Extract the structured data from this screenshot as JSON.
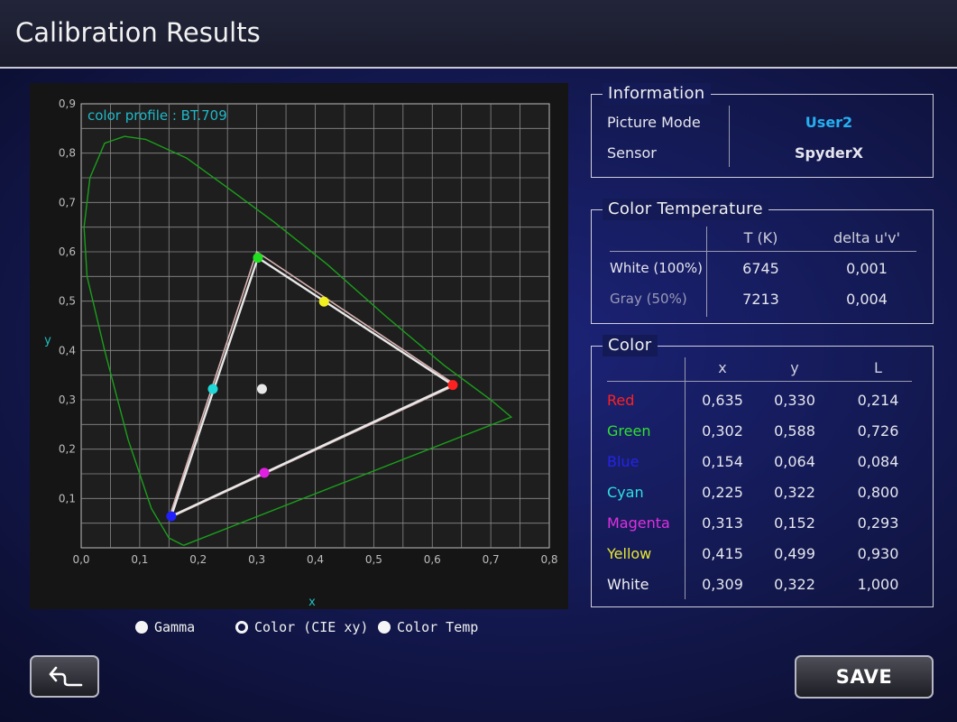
{
  "header": {
    "title": "Calibration Results"
  },
  "chart_data": {
    "type": "scatter",
    "profile_label": "color profile :  BT.709",
    "xlabel": "x",
    "ylabel": "y",
    "xlim": [
      0,
      0.8
    ],
    "ylim": [
      0,
      0.9
    ],
    "xticks": [
      "0,0",
      "0,1",
      "0,2",
      "0,3",
      "0,4",
      "0,5",
      "0,6",
      "0,7",
      "0,8"
    ],
    "yticks": [
      "0,1",
      "0,2",
      "0,3",
      "0,4",
      "0,5",
      "0,6",
      "0,7",
      "0,8",
      "0,9"
    ],
    "grid": true,
    "spectral_locus": [
      [
        0.175,
        0.005
      ],
      [
        0.15,
        0.02
      ],
      [
        0.12,
        0.08
      ],
      [
        0.08,
        0.22
      ],
      [
        0.04,
        0.4
      ],
      [
        0.01,
        0.55
      ],
      [
        0.005,
        0.65
      ],
      [
        0.015,
        0.75
      ],
      [
        0.04,
        0.82
      ],
      [
        0.074,
        0.834
      ],
      [
        0.11,
        0.828
      ],
      [
        0.18,
        0.79
      ],
      [
        0.25,
        0.73
      ],
      [
        0.33,
        0.66
      ],
      [
        0.42,
        0.575
      ],
      [
        0.52,
        0.47
      ],
      [
        0.62,
        0.37
      ],
      [
        0.7,
        0.3
      ],
      [
        0.735,
        0.265
      ],
      [
        0.175,
        0.005
      ]
    ],
    "reference_gamut": [
      [
        0.64,
        0.33
      ],
      [
        0.3,
        0.6
      ],
      [
        0.15,
        0.06
      ],
      [
        0.64,
        0.33
      ]
    ],
    "measured_gamut": [
      [
        0.635,
        0.33
      ],
      [
        0.302,
        0.588
      ],
      [
        0.154,
        0.064
      ],
      [
        0.635,
        0.33
      ]
    ],
    "points": [
      {
        "name": "Red",
        "x": 0.635,
        "y": 0.33,
        "color": "#ff2020"
      },
      {
        "name": "Green",
        "x": 0.302,
        "y": 0.588,
        "color": "#20e020"
      },
      {
        "name": "Blue",
        "x": 0.154,
        "y": 0.064,
        "color": "#2020ff"
      },
      {
        "name": "Cyan",
        "x": 0.225,
        "y": 0.322,
        "color": "#20d8d8"
      },
      {
        "name": "Magenta",
        "x": 0.313,
        "y": 0.152,
        "color": "#e020e0"
      },
      {
        "name": "Yellow",
        "x": 0.415,
        "y": 0.499,
        "color": "#f0f020"
      },
      {
        "name": "White",
        "x": 0.309,
        "y": 0.322,
        "color": "#e8e8e8"
      }
    ]
  },
  "view_options": {
    "items": [
      {
        "label": "Gamma",
        "selected": false
      },
      {
        "label": "Color (CIE xy)",
        "selected": true
      },
      {
        "label": "Color Temp",
        "selected": false
      }
    ]
  },
  "information": {
    "title": "Information",
    "picture_mode_label": "Picture Mode",
    "picture_mode_value": "User2",
    "sensor_label": "Sensor",
    "sensor_value": "SpyderX"
  },
  "color_temperature": {
    "title": "Color Temperature",
    "headers": [
      "T (K)",
      "delta u'v'"
    ],
    "rows": [
      {
        "label": "White (100%)",
        "t": "6745",
        "delta": "0,001"
      },
      {
        "label": "Gray (50%)",
        "t": "7213",
        "delta": "0,004"
      }
    ]
  },
  "color_table": {
    "title": "Color",
    "headers": [
      "x",
      "y",
      "L"
    ],
    "rows": [
      {
        "name": "Red",
        "x": "0,635",
        "y": "0,330",
        "l": "0,214",
        "color": "#ff2020"
      },
      {
        "name": "Green",
        "x": "0,302",
        "y": "0,588",
        "l": "0,726",
        "color": "#30e030"
      },
      {
        "name": "Blue",
        "x": "0,154",
        "y": "0,064",
        "l": "0,084",
        "color": "#2424e8"
      },
      {
        "name": "Cyan",
        "x": "0,225",
        "y": "0,322",
        "l": "0,800",
        "color": "#30e0e0"
      },
      {
        "name": "Magenta",
        "x": "0,313",
        "y": "0,152",
        "l": "0,293",
        "color": "#e030e0"
      },
      {
        "name": "Yellow",
        "x": "0,415",
        "y": "0,499",
        "l": "0,930",
        "color": "#e8e830"
      },
      {
        "name": "White",
        "x": "0,309",
        "y": "0,322",
        "l": "1,000",
        "color": "#f0f0f0"
      }
    ]
  },
  "buttons": {
    "back_icon": "return-arrow-icon",
    "save_label": "SAVE"
  },
  "colors": {
    "accent_text": "#26b0f0",
    "profile_label": "#20b8c8",
    "axis_label": "#20c0c0",
    "grid": "#8a8a8a",
    "locus": "#1aa01a",
    "reference_gamut": "#d8b0b0",
    "measured_gamut": "#e8e8e8"
  }
}
